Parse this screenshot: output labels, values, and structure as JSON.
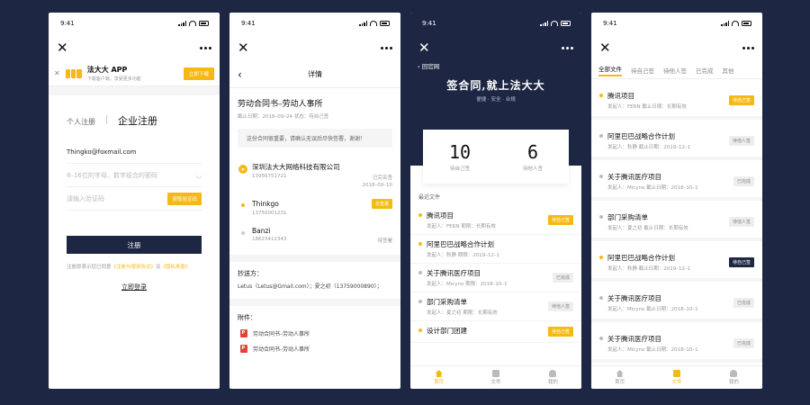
{
  "status_time": "9:41",
  "p1": {
    "banner": {
      "title": "法大大 APP",
      "subtitle": "下载客户端，享受更多功能",
      "button": "立即下载"
    },
    "tabs": {
      "personal": "个人注册",
      "enterprise": "企业注册"
    },
    "email_value": "Thingko@foxmail.com",
    "password_placeholder": "8–16位的字母、数字组合的密码",
    "code_placeholder": "请输入验证码",
    "code_button": "获取验证码",
    "register_button": "注册",
    "agree_prefix": "注册即表示您已同意",
    "agree_terms": "《注册与使用协议》",
    "agree_and": "及",
    "agree_privacy": "《隐私条款》",
    "login_link": "立即登录"
  },
  "p2": {
    "title": "详情",
    "doc_title": "劳动合同书–劳动人事所",
    "doc_meta": "截止日期：2018–09–24    状态：待自己签",
    "notice": "这份合同很重要，请确认无误后尽快签署，谢谢！",
    "parties": [
      {
        "name": "深圳法大大网络科技有限公司",
        "phone": "13956751721",
        "status": "已完名签",
        "date": "2018–09–10"
      },
      {
        "name": "Thinkgo",
        "phone": "13750001231",
        "status": "去签署"
      },
      {
        "name": "Banzi",
        "phone": "18623412343",
        "status": "待签署"
      }
    ],
    "cc_label": "抄送方：",
    "cc_value": "Letus（Letus@Gmail.com）；夏之初（13759000890）；",
    "attach_label": "附件：",
    "attachments": [
      "劳动合同书–劳动人事所",
      "劳动合同书–劳动人事所"
    ]
  },
  "p3": {
    "back": "回官网",
    "brand": "签合同,就上法大大",
    "slogan": "便捷 · 安全 · 合规",
    "stats": [
      {
        "num": "10",
        "label": "待自己签"
      },
      {
        "num": "6",
        "label": "待他人签"
      }
    ],
    "recent_label": "最近文件",
    "items": [
      {
        "name": "腾讯项目",
        "meta": "发起人：FERN    期限：长期有效",
        "tag": "待自己签",
        "tagtype": "y",
        "dot": "y"
      },
      {
        "name": "阿里巴巴战略合作计划",
        "meta": "发起人：秋静    期限：2019–12–1",
        "tag": "",
        "tagtype": "",
        "dot": "y"
      },
      {
        "name": "关于腾讯医疗项目",
        "meta": "发起人：Micyno    期限：2018–10–1",
        "tag": "已完成",
        "tagtype": "g",
        "dot": "g"
      },
      {
        "name": "部门采购清单",
        "meta": "发起人：夏之初    期限：长期有效",
        "tag": "待他人签",
        "tagtype": "g",
        "dot": "g"
      },
      {
        "name": "设计部门团建",
        "meta": "",
        "tag": "待自己签",
        "tagtype": "y",
        "dot": "y"
      }
    ]
  },
  "tabbar": {
    "home": "首页",
    "files": "文件",
    "me": "我的"
  },
  "p4": {
    "tabs": [
      "全部文件",
      "待自己签",
      "待他人签",
      "已完成",
      "其他"
    ],
    "items": [
      {
        "name": "腾讯项目",
        "meta": "发起人：FERN    截止日期：长期有效",
        "tag": "待自己签",
        "tagtype": "y",
        "dot": "y"
      },
      {
        "name": "阿里巴巴战略合作计划",
        "meta": "发起人：秋静    截止日期：2019–12–1",
        "tag": "待他人签",
        "tagtype": "g",
        "dot": "g"
      },
      {
        "name": "关于腾讯医疗项目",
        "meta": "发起人：Micyno    截止日期：2018–10–1",
        "tag": "已完成",
        "tagtype": "g",
        "dot": "g"
      },
      {
        "name": "部门采购清单",
        "meta": "发起人：夏之初    截止日期：长期有效",
        "tag": "待他人签",
        "tagtype": "g",
        "dot": "g"
      },
      {
        "name": "阿里巴巴战略合作计划",
        "meta": "发起人：秋静    截止日期：2019–12–1",
        "tag": "待自己签",
        "tagtype": "n",
        "dot": "y"
      },
      {
        "name": "关于腾讯医疗项目",
        "meta": "发起人：Micyno    截止日期：2018–10–1",
        "tag": "已完成",
        "tagtype": "g",
        "dot": "g"
      },
      {
        "name": "关于腾讯医疗项目",
        "meta": "发起人：Micyno    截止日期：2018–10–1",
        "tag": "已完成",
        "tagtype": "g",
        "dot": "g"
      }
    ]
  },
  "colors": {
    "navy": "#1d2743",
    "yellow": "#f5b915"
  }
}
